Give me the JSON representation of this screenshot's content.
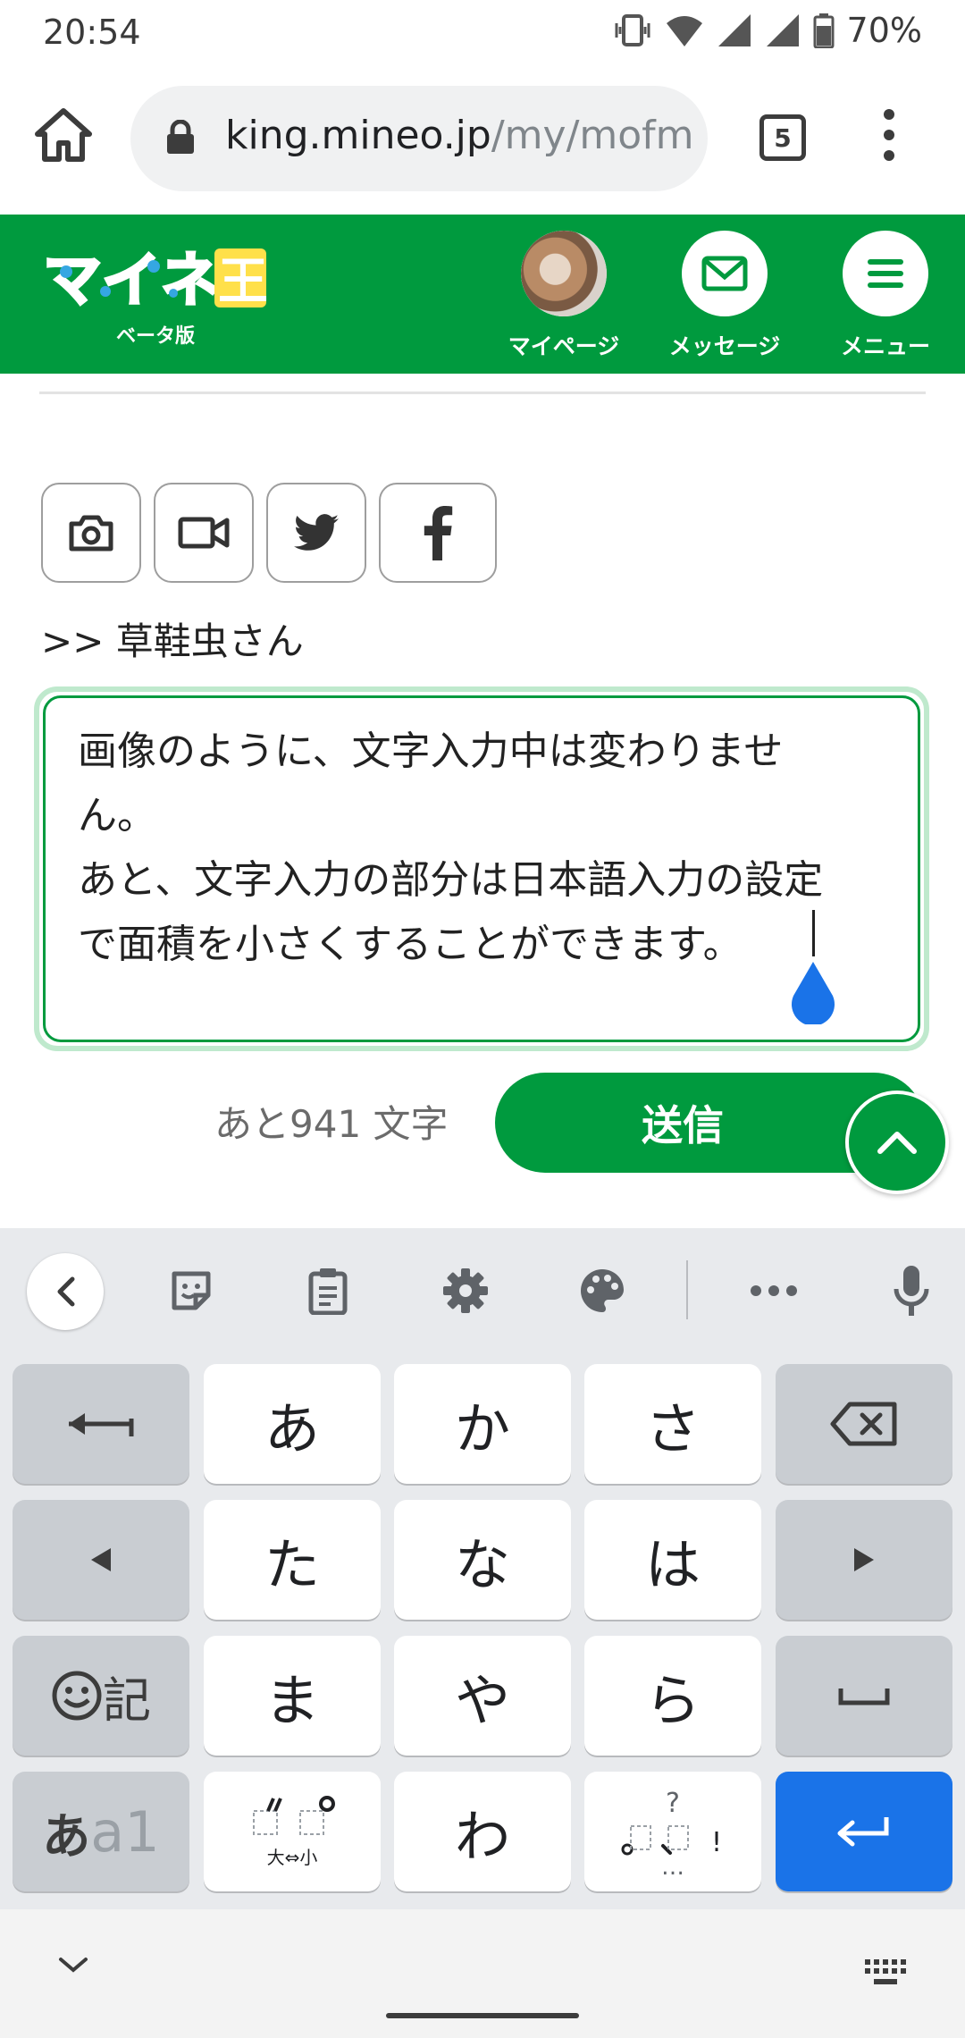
{
  "status_bar": {
    "time": "20:54",
    "battery_percent": "70%"
  },
  "browser": {
    "url_host": "king.mineo.jp",
    "url_path": "/my/mofm",
    "tab_count": "5"
  },
  "site_header": {
    "logo_text": "マイネ王",
    "logo_sub": "ベータ版",
    "nav": [
      {
        "label": "マイページ"
      },
      {
        "label": "メッセージ"
      },
      {
        "label": "メニュー"
      }
    ],
    "brand_color": "#009a3e"
  },
  "composer": {
    "attach_buttons": [
      "camera-icon",
      "video-icon",
      "twitter-icon",
      "facebook-icon"
    ],
    "reply_to": ">> 草鞋虫さん",
    "text_lines": [
      "画像のように、文字入力中は変わりませ",
      "ん。",
      "あと、文字入力の部分は日本語入力の設定",
      "で面積を小さくすることができます。"
    ],
    "remaining": "あと941 文字",
    "send_label": "送信"
  },
  "keyboard": {
    "toolbar": [
      "back-icon",
      "sticker-icon",
      "clipboard-icon",
      "gear-icon",
      "palette-icon",
      "more-icon",
      "mic-icon"
    ],
    "row1": [
      "あ",
      "か",
      "さ"
    ],
    "row2": [
      "た",
      "な",
      "は"
    ],
    "row3": [
      "ま",
      "や",
      "ら"
    ],
    "row3_left": "記",
    "row4_left_a": "あ",
    "row4_left_b": "a1",
    "row4_dakuten_sub": "大⇔小",
    "row4_wa": "わ",
    "punct_top": "?",
    "punct_bottom": "…",
    "punct_right": "!",
    "enter_color": "#1a73e8"
  }
}
